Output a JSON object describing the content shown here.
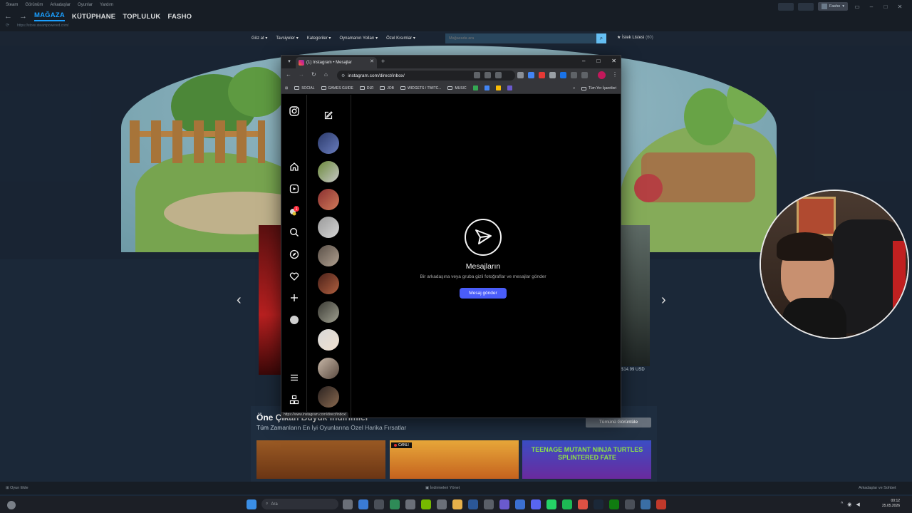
{
  "steam": {
    "menu": [
      "Steam",
      "Görünüm",
      "Arkadaşlar",
      "Oyunlar",
      "Yardım"
    ],
    "tabs": [
      "MAĞAZA",
      "KÜTÜPHANE",
      "TOPLULUK",
      "FASHO"
    ],
    "url": "https://store.steampowered.com/",
    "username": "Fasho",
    "store_menu": [
      "Göz at",
      "Tavsiyeler",
      "Kategoriler",
      "Oynamanın Yolları",
      "Özel Kısımlar"
    ],
    "search_placeholder": "Mağazada ara",
    "wishlist": "İstek Listesi",
    "wishlist_count": "(60)",
    "price_right": "$14.99 USD",
    "featured_title": "Öne Çıkan Büyük İndirimler",
    "featured_sub": "Tüm Zamanların En İyi Oyunlarına Özel Harika Fırsatlar",
    "featured_all": "Tümünü Görüntüle",
    "live_badge": "CANLI",
    "tile3_text": "TEENAGE MUTANT NINJA TURTLES SPLINTERED FATE",
    "add_game": "Oyun Ekle",
    "downloads": "İndirmeleri Yönet",
    "friends_chat": "Arkadaşlar ve Sohbet"
  },
  "browser": {
    "tab_title": "(1) Instagram • Mesajlar",
    "url": "instagram.com/direct/inbox/",
    "bookmarks": [
      "SOCIAL",
      "GAMES GUIDE",
      "DIZI",
      "JOB",
      "WIDGETS / TWITC...",
      "MUSIC"
    ],
    "all_bookmarks": "Tüm Yer İşaretleri",
    "status_url": "https://www.instagram.com/direct/inbox/"
  },
  "instagram": {
    "messages_title": "Mesajların",
    "messages_sub": "Bir arkadaşına veya gruba gizli fotoğraflar ve mesajlar gönder",
    "send_button": "Mesaj gönder",
    "notification_count": "1"
  },
  "taskbar": {
    "search_label": "Ara",
    "time": "00:12",
    "date": "25.05.2026"
  }
}
